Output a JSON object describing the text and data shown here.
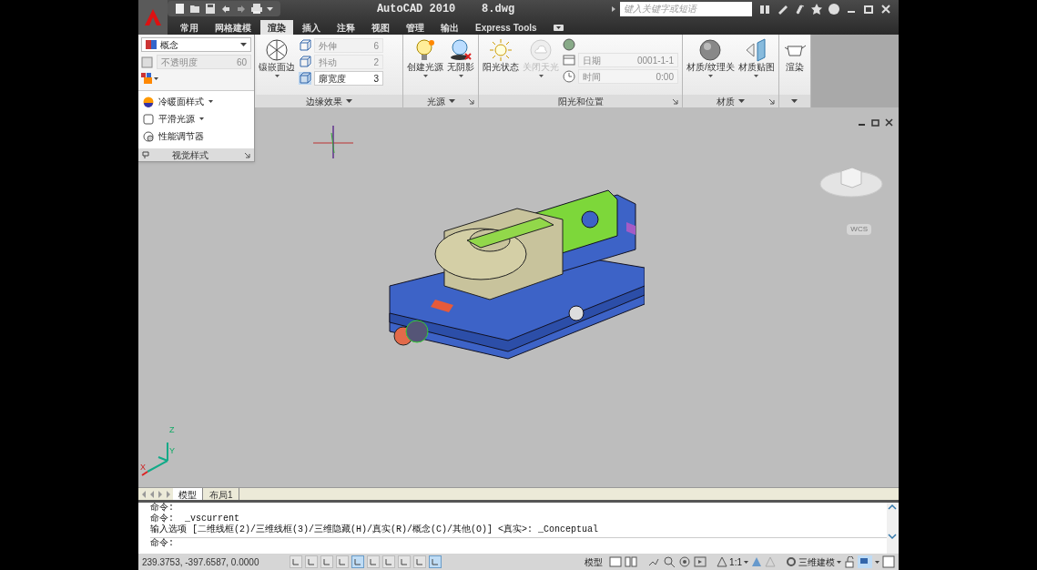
{
  "title": "AutoCAD 2010    8.dwg",
  "search": {
    "placeholder": "键入关键字或短语"
  },
  "ribbon_tabs": [
    {
      "label": "常用",
      "selected": false
    },
    {
      "label": "网格建模",
      "selected": false
    },
    {
      "label": "渲染",
      "selected": true
    },
    {
      "label": "插入",
      "selected": false
    },
    {
      "label": "注释",
      "selected": false
    },
    {
      "label": "视图",
      "selected": false
    },
    {
      "label": "管理",
      "selected": false
    },
    {
      "label": "输出",
      "selected": false
    },
    {
      "label": "Express Tools",
      "selected": false
    }
  ],
  "visual_styles": {
    "style": "概念",
    "opacity_label": "不透明度",
    "opacity_value": "60",
    "opacity_disabled": true,
    "items": [
      {
        "label": "冷暖面样式",
        "dropdown": true
      },
      {
        "label": "平滑光源",
        "dropdown": true
      },
      {
        "label": "性能调节器",
        "dropdown": false
      }
    ],
    "title": "视觉样式"
  },
  "edge_effects": {
    "big_button": "镶嵌面边",
    "rows": [
      {
        "label": "外伸",
        "value": "6",
        "disabled": true
      },
      {
        "label": "抖动",
        "value": "2",
        "disabled": true
      },
      {
        "label": "廓宽度",
        "value": "3",
        "disabled": false
      }
    ],
    "title": "边缘效果"
  },
  "lights": {
    "buttons": [
      "创建光源",
      "无阴影"
    ],
    "title": "光源"
  },
  "sun": {
    "status": "阳光状态",
    "sky": "关闭天光",
    "fields_disabled": true,
    "date_label": "日期",
    "date_value": "0001-1-1",
    "time_label": "时间",
    "time_value": "0:00",
    "title": "阳光和位置"
  },
  "materials": {
    "buttons": [
      "材质/纹理关",
      "材质贴图"
    ],
    "title": "材质"
  },
  "render": {
    "button": "渲染"
  },
  "viewport": {
    "wcs": "WCS",
    "ucs_labels": [
      "Z",
      "Y",
      "X"
    ]
  },
  "layout_tabs": [
    {
      "label": "模型",
      "selected": true
    },
    {
      "label": "布局1",
      "selected": false
    }
  ],
  "command_lines": [
    "命令:",
    "命令:  _vscurrent",
    "输入选项 [二维线框(2)/三维线框(3)/三维隐藏(H)/真实(R)/概念(C)/其他(O)] <真实>: _Conceptual"
  ],
  "command_prompt": "命令:",
  "status_bar": {
    "coords": "239.3753, -397.6587, 0.0000",
    "toggles": [
      {
        "on": false
      },
      {
        "on": false
      },
      {
        "on": false
      },
      {
        "on": false
      },
      {
        "on": true
      },
      {
        "on": false
      },
      {
        "on": false
      },
      {
        "on": false
      },
      {
        "on": false
      },
      {
        "on": true
      }
    ],
    "model": "模型",
    "scale": "1:1",
    "workspace": "三维建模"
  }
}
